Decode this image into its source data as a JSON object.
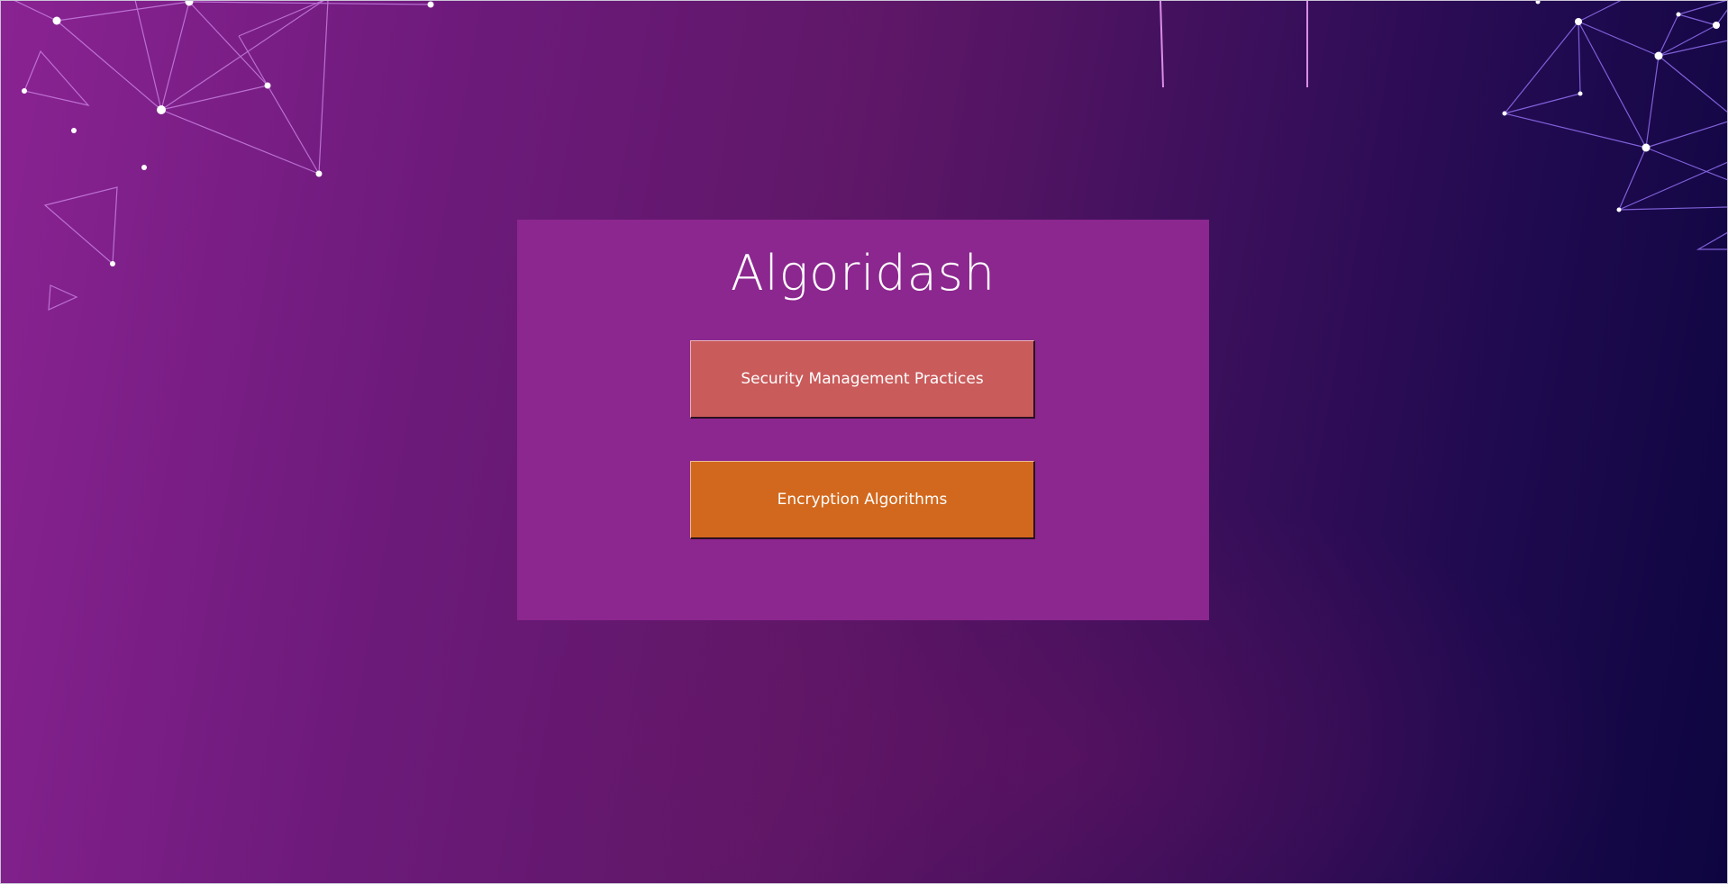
{
  "app": {
    "title": "Algoridash"
  },
  "menu": {
    "buttons": [
      {
        "label": "Security Management Practices",
        "color": "#ca5b5b"
      },
      {
        "label": "Encryption Algorithms",
        "color": "#d2681d"
      }
    ]
  },
  "theme": {
    "panel_color": "#8c278f",
    "gradient_start": "#8a2392",
    "gradient_end": "#0d0540",
    "network_line_color": "#c77ee0",
    "network_node_color": "#ffffff"
  }
}
